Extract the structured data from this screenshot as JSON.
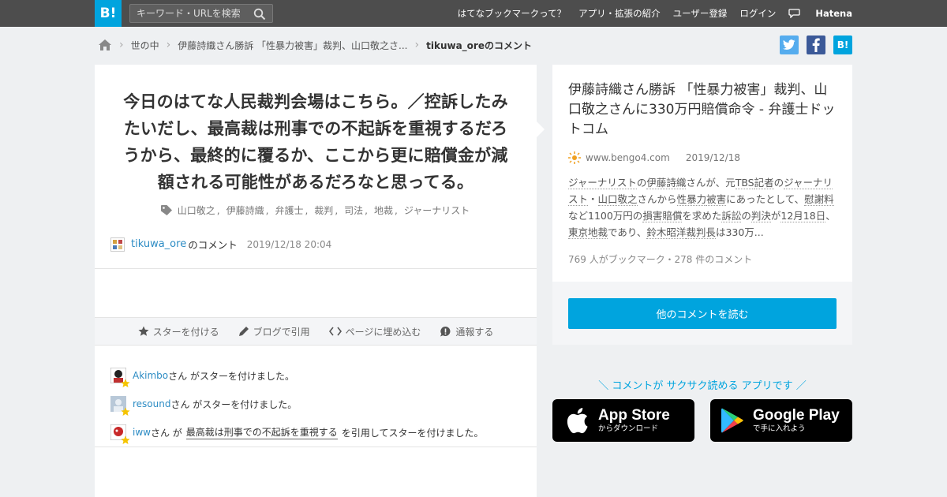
{
  "header": {
    "logo": "B!",
    "search_placeholder": "キーワード・URLを検索",
    "nav": [
      "はてなブックマークって？",
      "アプリ・拡張の紹介",
      "ユーザー登録",
      "ログイン"
    ],
    "brand": "Hatena"
  },
  "breadcrumb": {
    "category": "世の中",
    "entry": "伊藤詩織さん勝訴 「性暴力被害」裁判、山口敬之さ...",
    "current": "tikuwa_oreのコメント"
  },
  "share": {
    "twitter": "t",
    "facebook": "f",
    "hatena": "B!"
  },
  "comment": {
    "text": "今日のはてな人民裁判会場はこちら。／控訴したみたいだし、最高裁は刑事での不起訴を重視するだろうから、最終的に覆るか、ここから更に賠償金が減額される可能性があるだろなと思ってる。",
    "tags": [
      "山口敬之",
      "伊藤詩織",
      "弁護士",
      "裁判",
      "司法",
      "地裁",
      "ジャーナリスト"
    ],
    "username": "tikuwa_ore",
    "suffix": "のコメント",
    "timestamp": "2019/12/18 20:04"
  },
  "actions": {
    "star": "スターを付ける",
    "blog": "ブログで引用",
    "embed": "ページに埋め込む",
    "report": "通報する"
  },
  "stars": [
    {
      "user": "Akimbo",
      "text": "さん がスターを付けました。"
    },
    {
      "user": "resound",
      "text": "さん がスターを付けました。"
    },
    {
      "user": "iww",
      "mid": "さん が",
      "quote": "最高裁は刑事での不起訴を重視する",
      "text": "を引用してスターを付けました。"
    }
  ],
  "entry": {
    "title": "伊藤詩織さん勝訴 「性暴力被害」裁判、山口敬之さんに330万円賠償命令 - 弁護士ドットコム",
    "domain": "www.bengo4.com",
    "date": "2019/12/18",
    "summary_parts": [
      {
        "t": "ジャーナリスト",
        "k": true
      },
      {
        "t": "の",
        "k": false
      },
      {
        "t": "伊藤詩織",
        "k": true
      },
      {
        "t": "さんが、元",
        "k": false
      },
      {
        "t": "TBS",
        "k": true
      },
      {
        "t": "記者",
        "k": true
      },
      {
        "t": "の",
        "k": false
      },
      {
        "t": "ジャーナリスト",
        "k": true
      },
      {
        "t": "・",
        "k": false
      },
      {
        "t": "山口敬之",
        "k": true
      },
      {
        "t": "さんから",
        "k": false
      },
      {
        "t": "性暴力",
        "k": true
      },
      {
        "t": "被害",
        "k": true
      },
      {
        "t": "にあったとして、",
        "k": false
      },
      {
        "t": "慰謝料",
        "k": true
      },
      {
        "t": "など1100万円の",
        "k": false
      },
      {
        "t": "損害賠償",
        "k": true
      },
      {
        "t": "を求めた",
        "k": false
      },
      {
        "t": "訴訟",
        "k": true
      },
      {
        "t": "の",
        "k": false
      },
      {
        "t": "判決",
        "k": true
      },
      {
        "t": "が",
        "k": false
      },
      {
        "t": "12月18日",
        "k": true
      },
      {
        "t": "、",
        "k": false
      },
      {
        "t": "東京地裁",
        "k": true
      },
      {
        "t": "であり、",
        "k": false
      },
      {
        "t": "鈴木昭洋",
        "k": true
      },
      {
        "t": "裁判長",
        "k": true
      },
      {
        "t": "は330万...",
        "k": false
      }
    ],
    "counts": "769 人がブックマーク・278 件のコメント",
    "read_button": "他のコメントを読む"
  },
  "app": {
    "copy": "＼ コメントが サクサク読める アプリです ／",
    "appstore_big": "App Store",
    "appstore_small": "からダウンロード",
    "googleplay_big": "Google Play",
    "googleplay_small": "で手に入れよう"
  },
  "colors": {
    "accent": "#00a4de",
    "header": "#4d4d4d",
    "link": "#2d8cc4",
    "twitter": "#55acee",
    "facebook": "#3b5998"
  }
}
